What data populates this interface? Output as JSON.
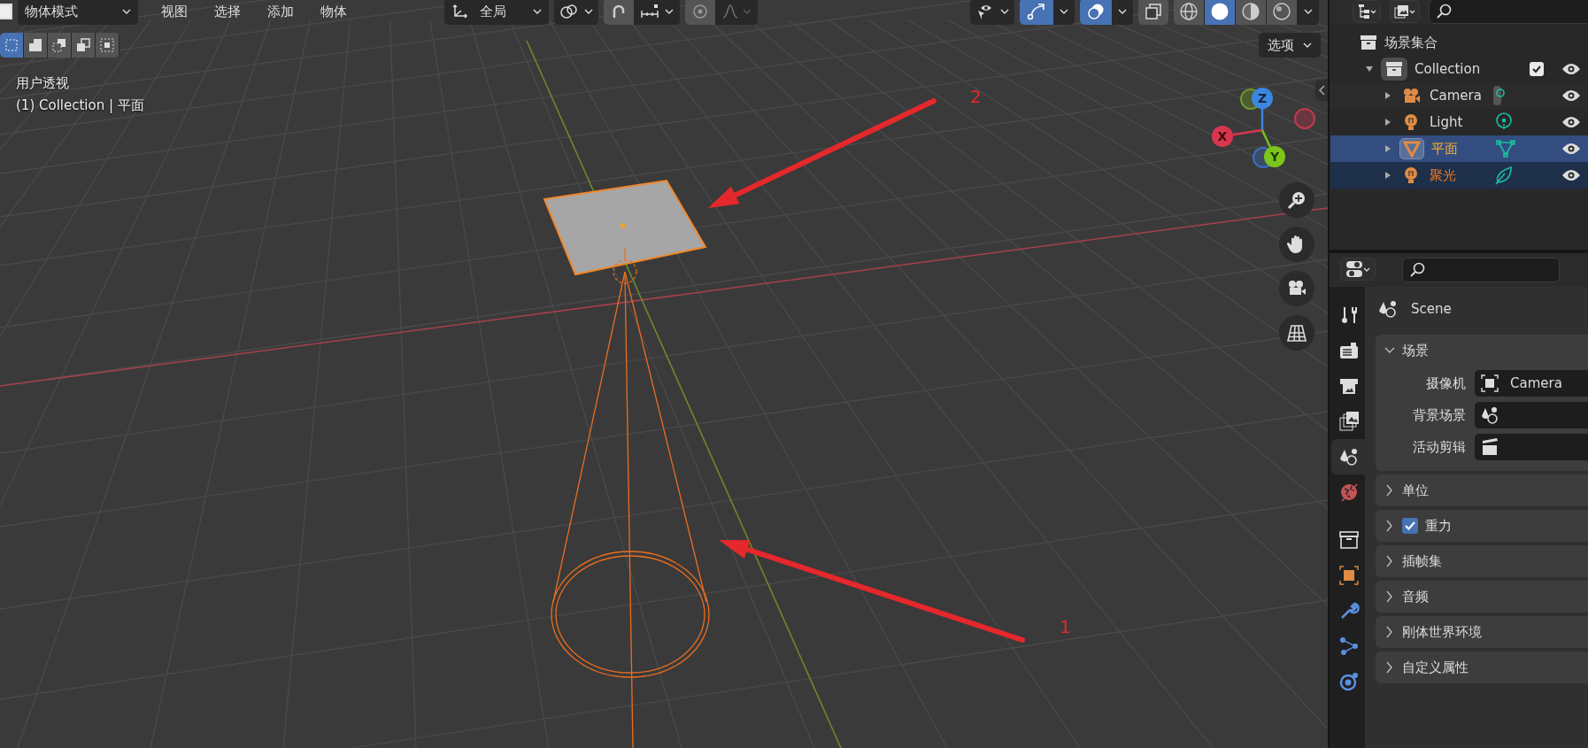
{
  "viewport": {
    "mode": "物体模式",
    "menus": [
      "视图",
      "选择",
      "添加",
      "物体"
    ],
    "orientation": "全局",
    "gizmos_on": true,
    "overlays_on": true,
    "xray_on": false,
    "select_modes": [
      {
        "selected": true
      },
      {
        "selected": false
      },
      {
        "selected": false
      },
      {
        "selected": false
      },
      {
        "selected": false
      }
    ],
    "shading": [
      {
        "kind": "wireframe",
        "selected": false
      },
      {
        "kind": "solid",
        "selected": true
      },
      {
        "kind": "material",
        "selected": false
      },
      {
        "kind": "rendered",
        "selected": false
      }
    ],
    "options": "选项",
    "view_name": "用户透视",
    "object_info": "(1) Collection | 平面",
    "gizmo": {
      "z": "Z",
      "x": "X",
      "y": "Y"
    },
    "callouts": [
      {
        "label": "2"
      },
      {
        "label": "1"
      }
    ]
  },
  "outliner": {
    "root": "场景集合",
    "collection": {
      "name": "Collection",
      "expanded": true,
      "checked": true,
      "children": [
        {
          "name": "Camera",
          "kind": "camera",
          "selected": false,
          "active": false
        },
        {
          "name": "Light",
          "kind": "point_light",
          "selected": false,
          "active": false
        },
        {
          "name": "平面",
          "kind": "mesh",
          "selected": true,
          "active": true
        },
        {
          "name": "聚光",
          "kind": "spot_light",
          "selected": true,
          "active": false
        }
      ]
    }
  },
  "properties": {
    "tabs": [
      {
        "kind": "tool",
        "selected": false
      },
      {
        "kind": "render",
        "selected": false
      },
      {
        "kind": "output",
        "selected": false
      },
      {
        "kind": "view_layer",
        "selected": false
      },
      {
        "kind": "scene",
        "selected": true
      },
      {
        "kind": "world",
        "selected": false
      },
      {
        "kind": "collection",
        "selected": false
      },
      {
        "kind": "object",
        "selected": false
      },
      {
        "kind": "modifiers",
        "selected": false
      },
      {
        "kind": "particles",
        "selected": false
      },
      {
        "kind": "physics",
        "selected": false
      }
    ],
    "title": "Scene",
    "panels": [
      {
        "title": "场景",
        "expanded": true,
        "fields": [
          {
            "label": "摄像机",
            "kind": "object",
            "value": "Camera"
          },
          {
            "label": "背景场景",
            "kind": "scene"
          },
          {
            "label": "活动剪辑",
            "kind": "clip"
          }
        ]
      },
      {
        "title": "单位",
        "expanded": false
      },
      {
        "title": "重力",
        "expanded": false,
        "checked": true
      },
      {
        "title": "插帧集",
        "expanded": false
      },
      {
        "title": "音频",
        "expanded": false
      },
      {
        "title": "刚体世界环境",
        "expanded": false
      },
      {
        "title": "自定义属性",
        "expanded": false
      }
    ]
  }
}
